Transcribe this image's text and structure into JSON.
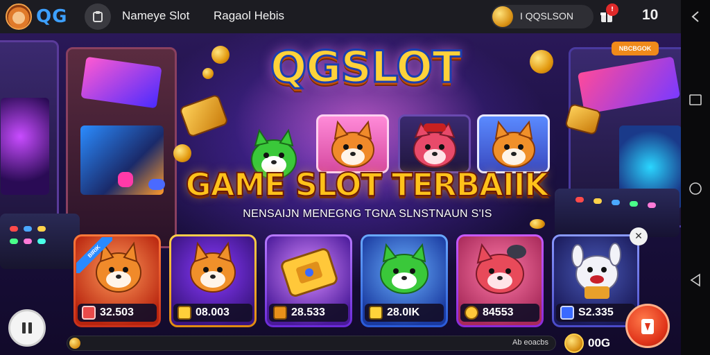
{
  "topbar": {
    "brand": "QG",
    "links": [
      "Nameye Slot",
      "Ragaol Hebis"
    ],
    "account_name": "I QQSLSON",
    "notification_count": "!",
    "counter": "10"
  },
  "hero": {
    "title": "QGSLOT",
    "badge": "NBCBGOK",
    "subtitle": "GAME SLOT TERBAIIK",
    "tagline": "NENSAIJN MENEGNG TGNA SLNSTNAUN S'IS"
  },
  "cards": [
    {
      "ribbon": "BIRIK",
      "value": "32.503",
      "character": "fox",
      "icon": "gift-box-icon"
    },
    {
      "value": "08.003",
      "character": "fox",
      "icon": "treasure-icon"
    },
    {
      "value": "28.533",
      "character": "treasure-chest",
      "icon": "chest-icon"
    },
    {
      "value": "28.0IK",
      "character": "green-cat",
      "icon": "gem-icon"
    },
    {
      "value": "84553",
      "character": "red-dog",
      "icon": "coin-icon"
    },
    {
      "value": "S2.335",
      "character": "robot-dog",
      "icon": "card-icon"
    }
  ],
  "bottom": {
    "progress_label": "Ab eoacbs",
    "progress_value": 0.02,
    "balance": "00G"
  },
  "colors": {
    "title_gold": "#ffd23a",
    "title_outline": "#1b3fb0",
    "brand_blue": "#3da0ff",
    "fab_red": "#e0341a"
  }
}
